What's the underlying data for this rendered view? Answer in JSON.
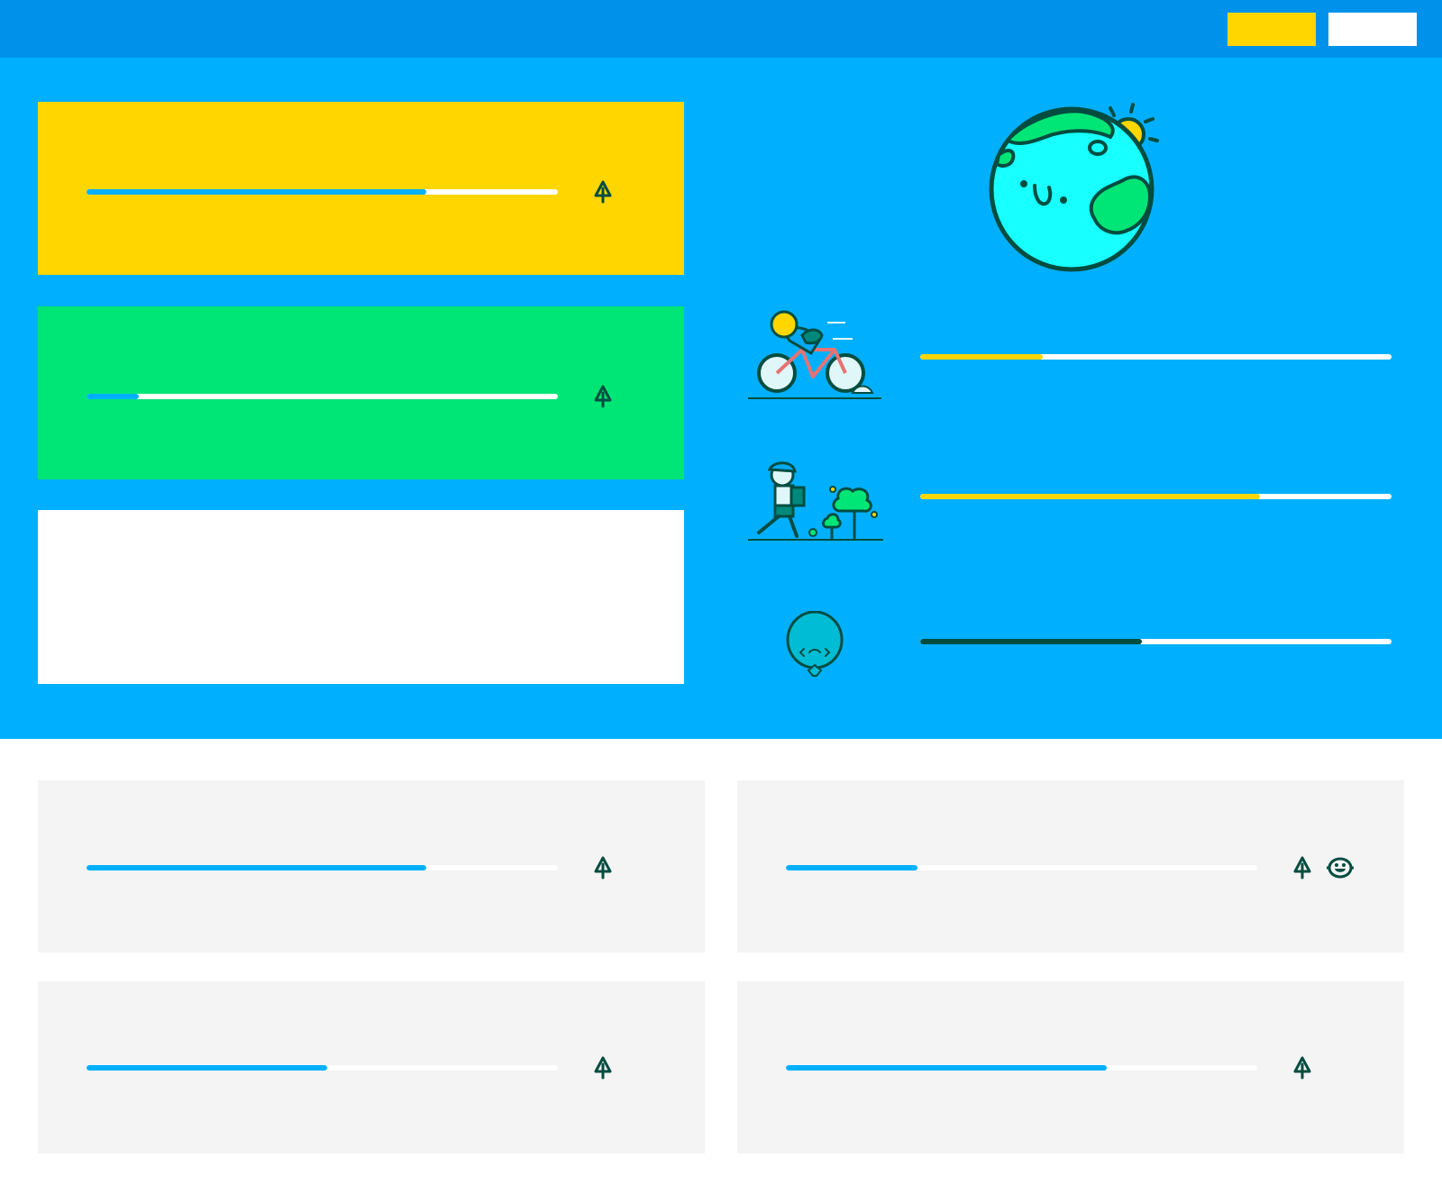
{
  "colors": {
    "topbar": "#0091ea",
    "hero_bg": "#00b0ff",
    "accent_yellow": "#ffd600",
    "accent_green": "#00e676",
    "progress_blue": "#00b0ff",
    "dark_teal": "#004d40",
    "card_gray": "#f4f4f4",
    "white": "#ffffff"
  },
  "header": {
    "primary_button": {
      "label": "",
      "color": "#ffd600"
    },
    "secondary_button": {
      "label": "",
      "color": "#ffffff"
    }
  },
  "hero": {
    "cards": [
      {
        "color": "#ffd600",
        "progress": 0.72,
        "icons": [
          "tree-icon"
        ]
      },
      {
        "color": "#00e676",
        "progress": 0.11,
        "icons": [
          "tree-icon"
        ]
      },
      {
        "color": "#ffffff",
        "progress": null,
        "icons": []
      }
    ],
    "illustration": "earth-illustration",
    "rows": [
      {
        "illustration": "cyclist-illustration",
        "progress": 0.26,
        "fill_color": "#ffd600"
      },
      {
        "illustration": "walker-illustration",
        "progress": 0.72,
        "fill_color": "#ffd600"
      },
      {
        "illustration": "balloon-illustration",
        "progress": 0.47,
        "fill_color": "#004d40"
      }
    ]
  },
  "main": {
    "cards": [
      {
        "progress": 0.72,
        "icons": [
          "tree-icon"
        ]
      },
      {
        "progress": 0.28,
        "icons": [
          "tree-icon",
          "smiley-icon"
        ]
      },
      {
        "progress": 0.51,
        "icons": [
          "tree-icon"
        ]
      },
      {
        "progress": 0.68,
        "icons": [
          "tree-icon"
        ]
      }
    ]
  }
}
